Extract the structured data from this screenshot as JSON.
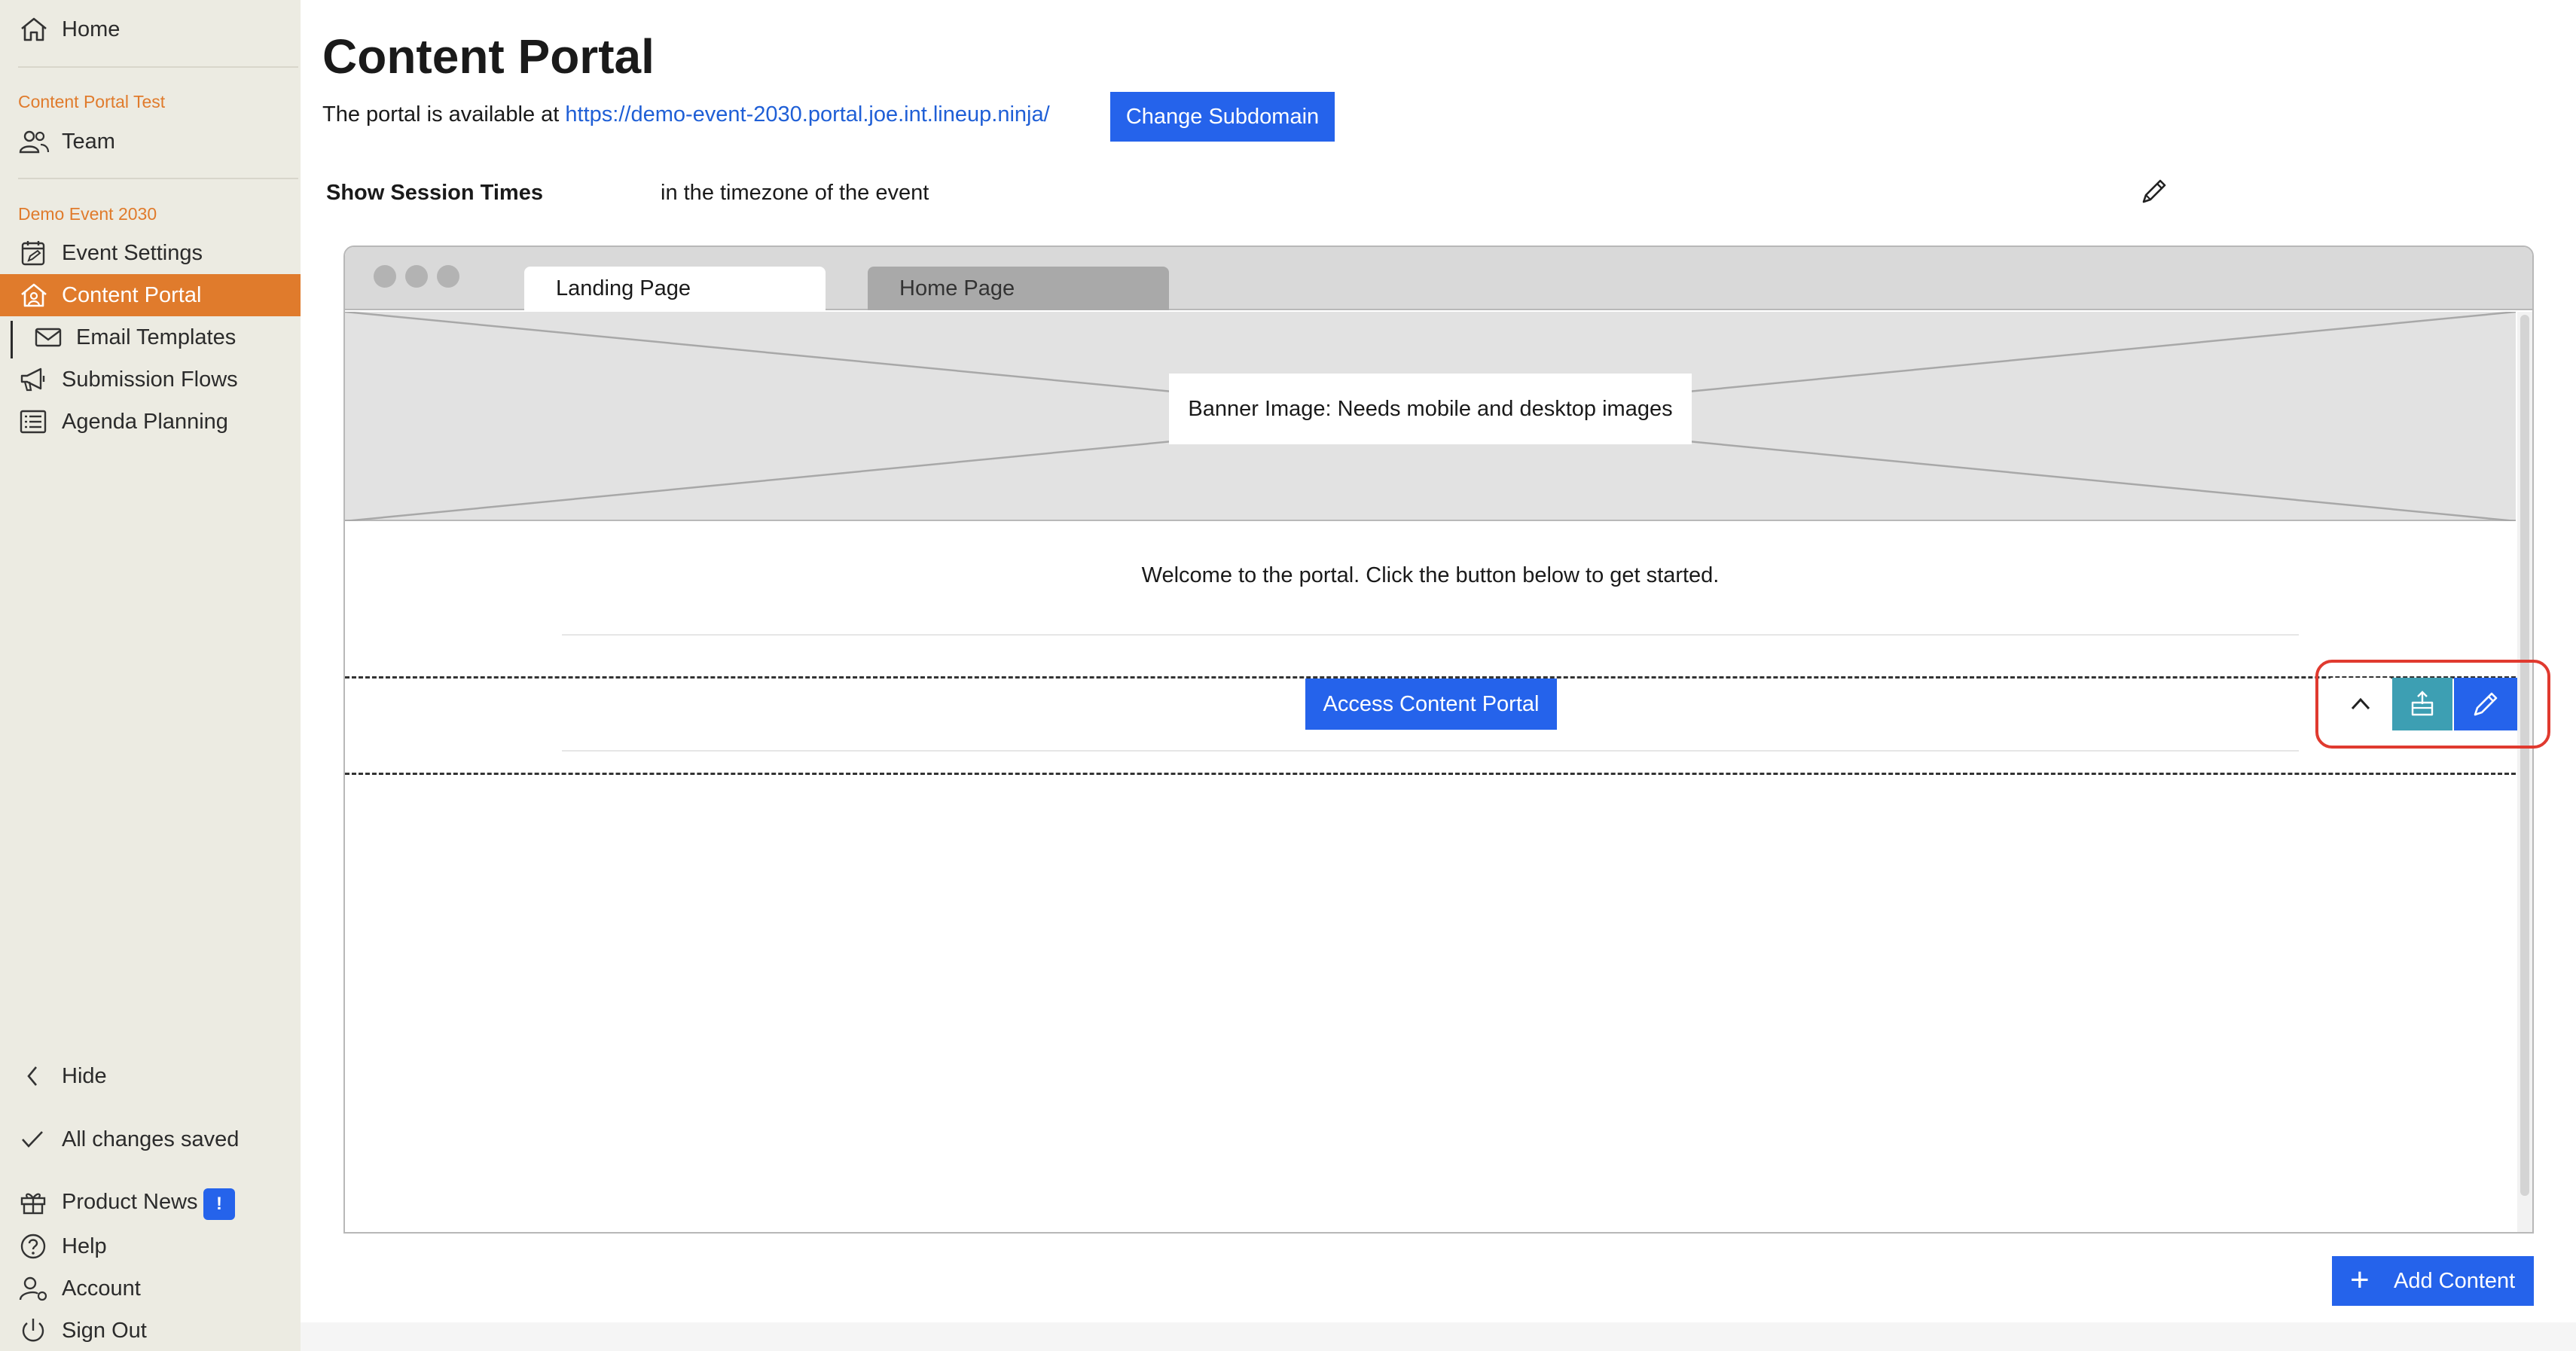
{
  "sidebar": {
    "home": {
      "label": "Home",
      "icon": "home-icon"
    },
    "team_section": "Content Portal Test",
    "team": {
      "label": "Team",
      "icon": "team-icon"
    },
    "event_section": "Demo Event 2030",
    "items": [
      {
        "label": "Event Settings",
        "icon": "calendar-edit-icon"
      },
      {
        "label": "Content Portal",
        "icon": "portal-home-icon",
        "active": true
      },
      {
        "label": "Email Templates",
        "icon": "envelope-icon"
      },
      {
        "label": "Submission Flows",
        "icon": "megaphone-icon"
      },
      {
        "label": "Agenda Planning",
        "icon": "list-icon"
      }
    ],
    "hide": "Hide",
    "status": "All changes saved",
    "product_news": "Product News",
    "product_news_badge": "!",
    "help": "Help",
    "account": "Account",
    "sign_out": "Sign Out"
  },
  "main": {
    "title": "Content Portal",
    "available_prefix": "The portal is available at",
    "portal_url": "https://demo-event-2030.portal.joe.int.lineup.ninja/",
    "change_subdomain": "Change Subdomain",
    "session_times_label": "Show Session Times",
    "session_times_value": "in the timezone of the event"
  },
  "preview": {
    "tabs": [
      "Landing Page",
      "Home Page"
    ],
    "banner_label": "Banner Image: Needs mobile and desktop images",
    "welcome_text": "Welcome to the portal. Click the button below to get started.",
    "access_button": "Access Content Portal"
  },
  "add_content": "Add Content",
  "colors": {
    "sidebar_bg": "#ecebe2",
    "accent_orange": "#e07b2c",
    "primary_blue": "#2563eb",
    "teal": "#3d9fb3",
    "highlight_red": "#e03a2f"
  }
}
